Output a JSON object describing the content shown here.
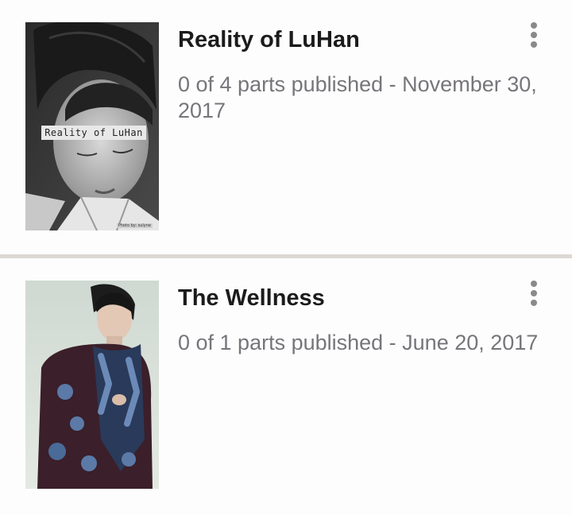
{
  "stories": [
    {
      "title": "Reality of LuHan",
      "meta": "0 of 4 parts published - November 30, 2017",
      "cover_text": "Reality of LuHan",
      "cover_credit": "Photo by: sulyne",
      "menu_icon": "more-vertical-icon"
    },
    {
      "title": "The Wellness",
      "meta": "0 of 1 parts published - June 20, 2017",
      "menu_icon": "more-vertical-icon"
    }
  ],
  "colors": {
    "title": "#1b1b1b",
    "meta": "#77757a",
    "divider": "#ddd8d3",
    "menu_dots": "#8a8a8a"
  }
}
